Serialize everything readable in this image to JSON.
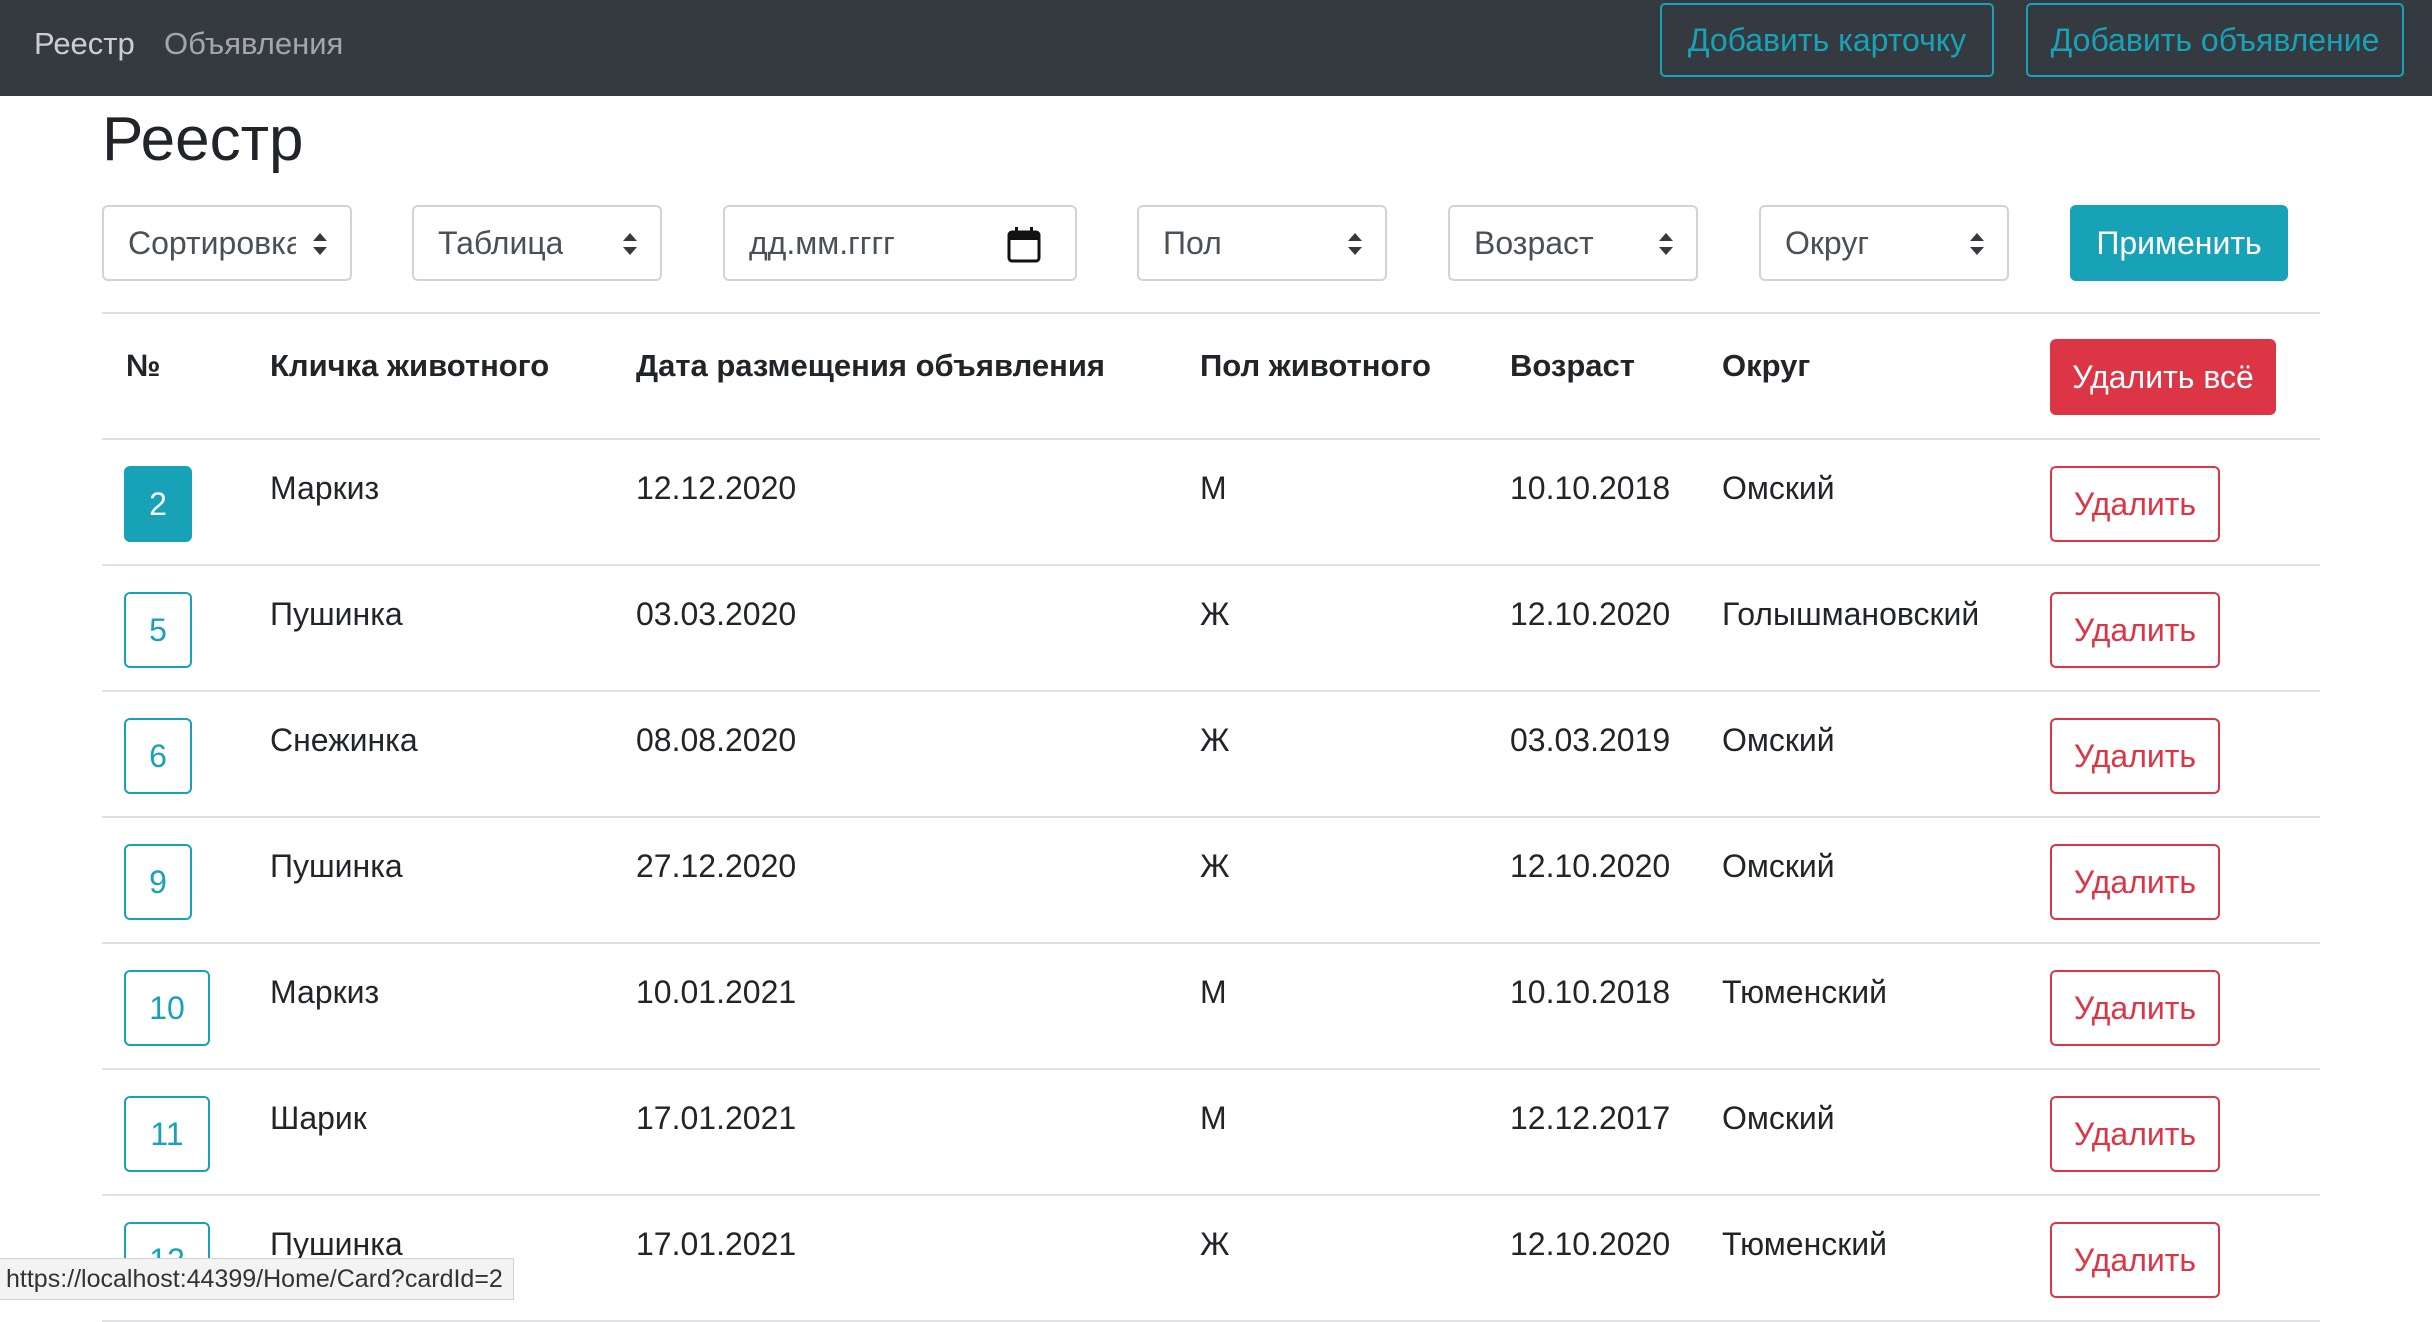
{
  "navbar": {
    "links": [
      "Реестр",
      "Объявления"
    ],
    "add_card_label": "Добавить карточку",
    "add_ad_label": "Добавить объявление"
  },
  "page": {
    "title": "Реестр"
  },
  "filters": {
    "sort": "Сортировка",
    "table": "Таблица",
    "date_placeholder": "дд.мм.гггг",
    "gender": "Пол",
    "age": "Возраст",
    "district": "Округ",
    "apply_label": "Применить"
  },
  "table": {
    "headers": [
      "№",
      "Кличка животного",
      "Дата размещения объявления",
      "Пол животного",
      "Возраст",
      "Округ"
    ],
    "delete_all_label": "Удалить всё",
    "delete_label": "Удалить",
    "rows": [
      {
        "id": "2",
        "name": "Маркиз",
        "date": "12.12.2020",
        "gender": "М",
        "age": "10.10.2018",
        "district": "Омский"
      },
      {
        "id": "5",
        "name": "Пушинка",
        "date": "03.03.2020",
        "gender": "Ж",
        "age": "12.10.2020",
        "district": "Голышмановский"
      },
      {
        "id": "6",
        "name": "Снежинка",
        "date": "08.08.2020",
        "gender": "Ж",
        "age": "03.03.2019",
        "district": "Омский"
      },
      {
        "id": "9",
        "name": "Пушинка",
        "date": "27.12.2020",
        "gender": "Ж",
        "age": "12.10.2020",
        "district": "Омский"
      },
      {
        "id": "10",
        "name": "Маркиз",
        "date": "10.01.2021",
        "gender": "М",
        "age": "10.10.2018",
        "district": "Тюменский"
      },
      {
        "id": "11",
        "name": "Шарик",
        "date": "17.01.2021",
        "gender": "М",
        "age": "12.12.2017",
        "district": "Омский"
      },
      {
        "id": "12",
        "name": "Пушинка",
        "date": "17.01.2021",
        "gender": "Ж",
        "age": "12.10.2020",
        "district": "Тюменский"
      }
    ]
  },
  "status_bar": {
    "url": "https://localhost:44399/Home/Card?cardId=2"
  },
  "colors": {
    "navbar": "#343a40",
    "info": "#17a2b8",
    "danger": "#dc3545",
    "border": "#dee2e6"
  }
}
